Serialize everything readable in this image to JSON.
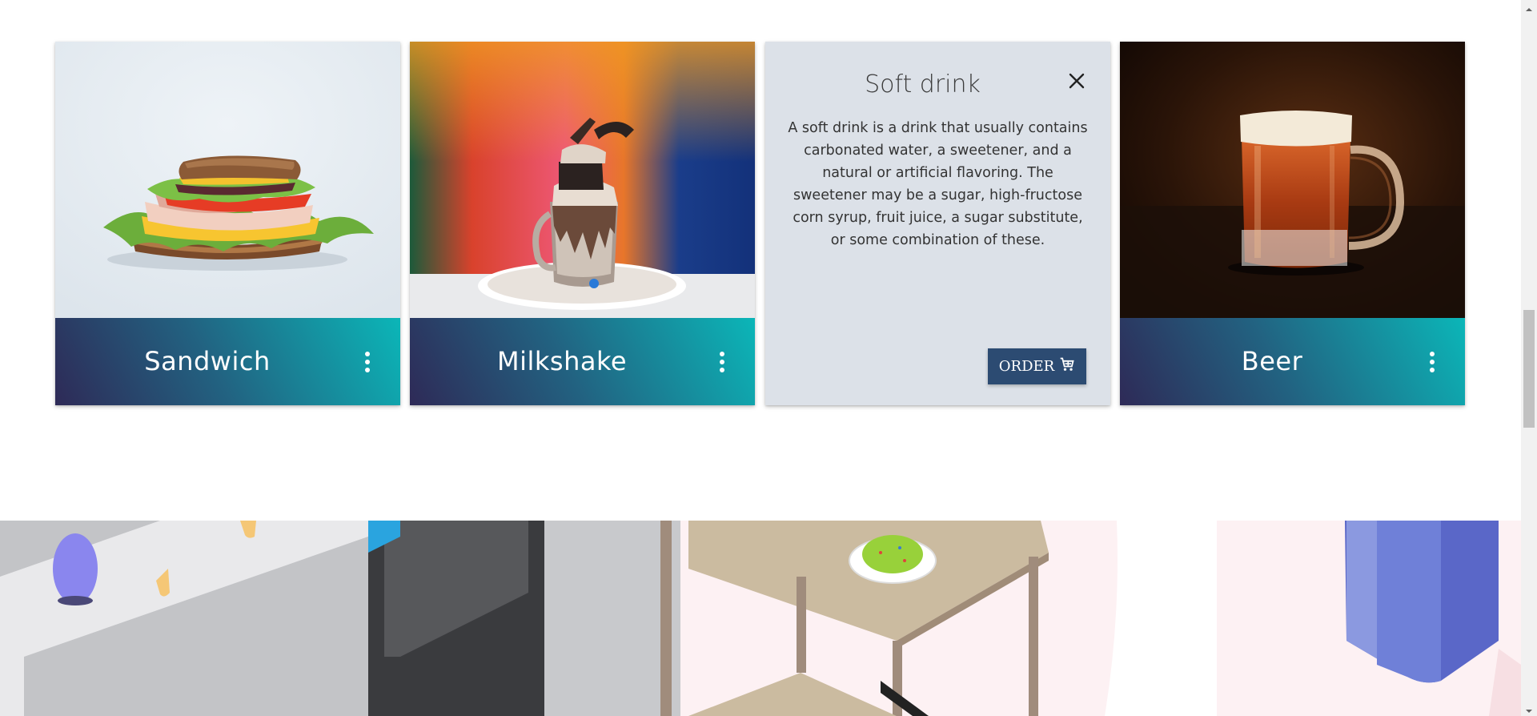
{
  "cards": [
    {
      "title": "Sandwich",
      "image": "sandwich-photo",
      "menu_icon": "more-vertical-icon"
    },
    {
      "title": "Milkshake",
      "image": "milkshake-photo",
      "menu_icon": "more-vertical-icon"
    },
    {
      "title": "Soft drink",
      "revealed": true,
      "description": "A soft drink is a drink that usually contains carbonated water, a sweetener, and a natural or artificial flavoring. The sweetener may be a sugar, high-fructose corn syrup, fruit juice, a sugar substitute, or some combination of these.",
      "close_icon": "close-icon",
      "order_label": "ORDER",
      "order_icon": "cart-icon"
    },
    {
      "title": "Beer",
      "image": "beer-photo",
      "menu_icon": "more-vertical-icon"
    }
  ],
  "colors": {
    "footer_gradient": [
      "#2e2a57",
      "#226281",
      "#0bb6b8"
    ],
    "reveal_background": "#dce1e8",
    "order_button": "#2c4b72"
  },
  "illustration": "kitchen-illustration",
  "scrollbar": {
    "position": 0.57
  }
}
